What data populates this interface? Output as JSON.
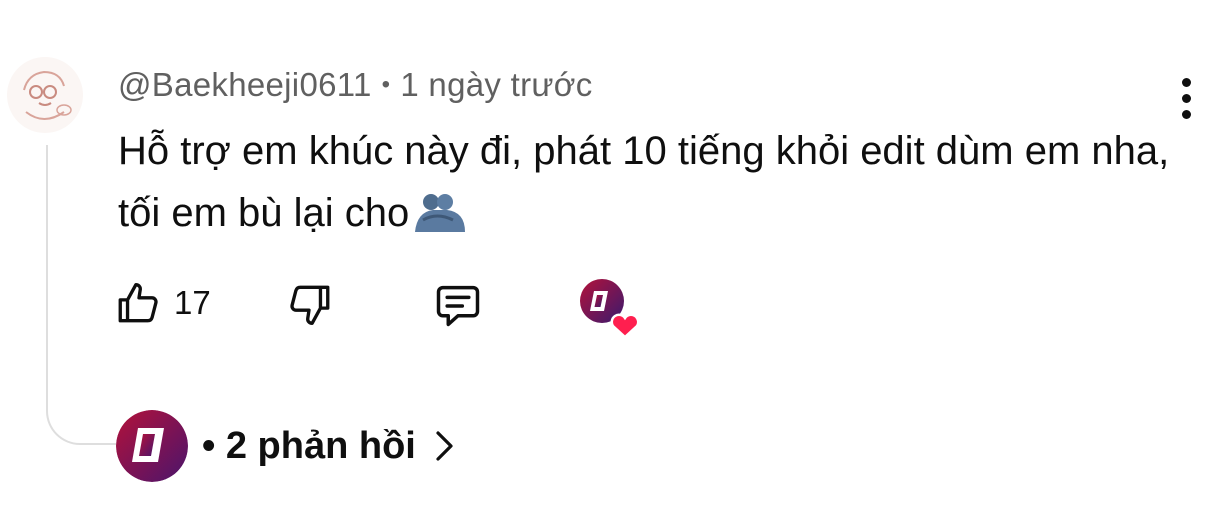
{
  "comment": {
    "author": "@Baekheeji0611",
    "separator": "•",
    "time": "1 ngày trước",
    "text": "Hỗ trợ em khúc này đi, phát 10 tiếng khỏi edit dùm em nha, tối em bù lại cho",
    "emoji": "people-hugging-emoji",
    "like_count": "17"
  },
  "replies": {
    "label": "• 2 phản hồi"
  },
  "colors": {
    "text_primary": "#0f0f0f",
    "text_secondary": "#606060",
    "thread_line": "#dedede",
    "heart": "#ff1f4f",
    "creator_avatar_bg": "#9a0c2c"
  },
  "icons": [
    "user-avatar-icon",
    "more-vert-icon",
    "thumbs-up-icon",
    "thumbs-down-icon",
    "comment-reply-icon",
    "creator-heart-icon",
    "creator-avatar-icon",
    "chevron-right-icon"
  ]
}
